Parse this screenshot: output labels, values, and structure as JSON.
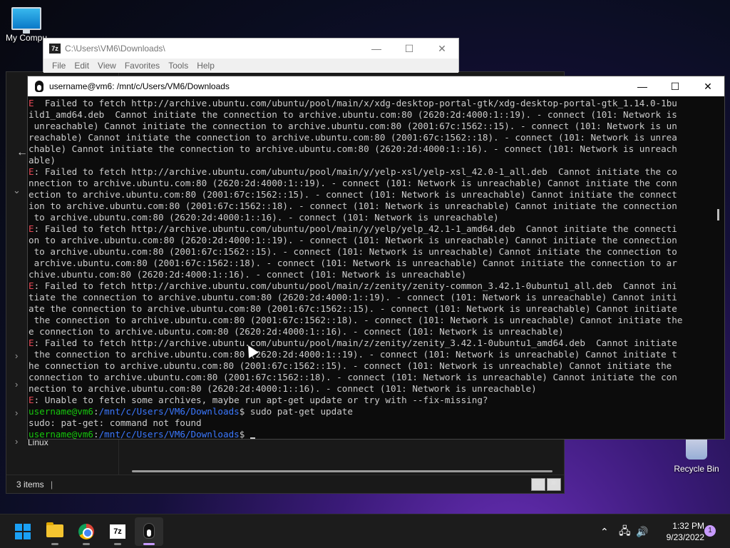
{
  "desktop": {
    "my_computer_label": "My Compu",
    "recycle_bin_label": "Recycle Bin"
  },
  "explorer": {
    "status_items": "3 items",
    "linux_label": "Linux"
  },
  "sevenzip": {
    "title": "C:\\Users\\VM6\\Downloads\\",
    "logo": "7z",
    "menu": [
      "File",
      "Edit",
      "View",
      "Favorites",
      "Tools",
      "Help"
    ]
  },
  "terminal": {
    "title": "username@vm6: /mnt/c/Users/VM6/Downloads",
    "lines": [
      [
        [
          "red",
          "E"
        ],
        [
          "",
          "  Failed to fetch http://archive.ubuntu.com/ubuntu/pool/main/x/xdg-desktop-portal-gtk/xdg-desktop-portal-gtk_1.14.0-1bu"
        ]
      ],
      [
        [
          "",
          "ild1_amd64.deb  Cannot initiate the connection to archive.ubuntu.com:80 (2620:2d:4000:1::19). - connect (101: Network is"
        ]
      ],
      [
        [
          "",
          "",
          " unreachable) Cannot initiate the connection to archive.ubuntu.com:80 (2001:67c:1562::15). - connect (101: Network is un"
        ]
      ],
      [
        [
          "",
          "reachable) Cannot initiate the connection to archive.ubuntu.com:80 (2001:67c:1562::18). - connect (101: Network is unrea"
        ]
      ],
      [
        [
          "",
          "chable) Cannot initiate the connection to archive.ubuntu.com:80 (2620:2d:4000:1::16). - connect (101: Network is unreach"
        ]
      ],
      [
        [
          "",
          "able)"
        ]
      ],
      [
        [
          "red",
          "E"
        ],
        [
          "",
          ": Failed to fetch http://archive.ubuntu.com/ubuntu/pool/main/y/yelp-xsl/yelp-xsl_42.0-1_all.deb  Cannot initiate the co"
        ]
      ],
      [
        [
          "",
          "nnection to archive.ubuntu.com:80 (2620:2d:4000:1::19). - connect (101: Network is unreachable) Cannot initiate the conn"
        ]
      ],
      [
        [
          "",
          "ection to archive.ubuntu.com:80 (2001:67c:1562::15). - connect (101: Network is unreachable) Cannot initiate the connect"
        ]
      ],
      [
        [
          "",
          "ion to archive.ubuntu.com:80 (2001:67c:1562::18). - connect (101: Network is unreachable) Cannot initiate the connection"
        ]
      ],
      [
        [
          "",
          " to archive.ubuntu.com:80 (2620:2d:4000:1::16). - connect (101: Network is unreachable)"
        ]
      ],
      [
        [
          "red",
          "E"
        ],
        [
          "",
          ": Failed to fetch http://archive.ubuntu.com/ubuntu/pool/main/y/yelp/yelp_42.1-1_amd64.deb  Cannot initiate the connecti"
        ]
      ],
      [
        [
          "",
          "on to archive.ubuntu.com:80 (2620:2d:4000:1::19). - connect (101: Network is unreachable) Cannot initiate the connection"
        ]
      ],
      [
        [
          "",
          " to archive.ubuntu.com:80 (2001:67c:1562::15). - connect (101: Network is unreachable) Cannot initiate the connection to"
        ]
      ],
      [
        [
          "",
          " archive.ubuntu.com:80 (2001:67c:1562::18). - connect (101: Network is unreachable) Cannot initiate the connection to ar"
        ]
      ],
      [
        [
          "",
          "chive.ubuntu.com:80 (2620:2d:4000:1::16). - connect (101: Network is unreachable)"
        ]
      ],
      [
        [
          "red",
          "E"
        ],
        [
          "",
          ": Failed to fetch http://archive.ubuntu.com/ubuntu/pool/main/z/zenity/zenity-common_3.42.1-0ubuntu1_all.deb  Cannot ini"
        ]
      ],
      [
        [
          "",
          "tiate the connection to archive.ubuntu.com:80 (2620:2d:4000:1::19). - connect (101: Network is unreachable) Cannot initi"
        ]
      ],
      [
        [
          "",
          "ate the connection to archive.ubuntu.com:80 (2001:67c:1562::15). - connect (101: Network is unreachable) Cannot initiate"
        ]
      ],
      [
        [
          "",
          " the connection to archive.ubuntu.com:80 (2001:67c:1562::18). - connect (101: Network is unreachable) Cannot initiate the"
        ]
      ],
      [
        [
          "",
          "e connection to archive.ubuntu.com:80 (2620:2d:4000:1::16). - connect (101: Network is unreachable)"
        ]
      ],
      [
        [
          "red",
          "E"
        ],
        [
          "",
          ": Failed to fetch http://archive.ubuntu.com/ubuntu/pool/main/z/zenity/zenity_3.42.1-0ubuntu1_amd64.deb  Cannot initiate"
        ]
      ],
      [
        [
          "",
          " the connection to archive.ubuntu.com:80 (2620:2d:4000:1::19). - connect (101: Network is unreachable) Cannot initiate t"
        ]
      ],
      [
        [
          "",
          "he connection to archive.ubuntu.com:80 (2001:67c:1562::15). - connect (101: Network is unreachable) Cannot initiate the"
        ]
      ],
      [
        [
          "",
          "connection to archive.ubuntu.com:80 (2001:67c:1562::18). - connect (101: Network is unreachable) Cannot initiate the con"
        ]
      ],
      [
        [
          "",
          "nection to archive.ubuntu.com:80 (2620:2d:4000:1::16). - connect (101: Network is unreachable)"
        ]
      ],
      [
        [
          "red",
          "E"
        ],
        [
          "",
          ": Unable to fetch some archives, maybe run apt-get update or try with --fix-missing?"
        ]
      ],
      [
        [
          "grn",
          "username@vm6"
        ],
        [
          "",
          ":"
        ],
        [
          "blu",
          "/mnt/c/Users/VM6/Downloads"
        ],
        [
          "",
          "$ sudo pat-get update"
        ]
      ],
      [
        [
          "",
          "sudo: pat-get: command not found"
        ]
      ],
      [
        [
          "grn",
          "username@vm6"
        ],
        [
          "",
          ":"
        ],
        [
          "blu",
          "/mnt/c/Users/VM6/Downloads"
        ],
        [
          "",
          "$ "
        ]
      ]
    ]
  },
  "taskbar": {
    "time": "1:32 PM",
    "date": "9/23/2022",
    "notification_count": "1",
    "apps": [
      "start",
      "file-explorer",
      "chrome",
      "7-zip",
      "ubuntu-terminal"
    ]
  },
  "colors": {
    "terminal_bg": "#0c0c0c",
    "error_red": "#e74856",
    "prompt_green": "#16c60c",
    "path_blue": "#3b78ff",
    "accent": "#c89bff"
  }
}
